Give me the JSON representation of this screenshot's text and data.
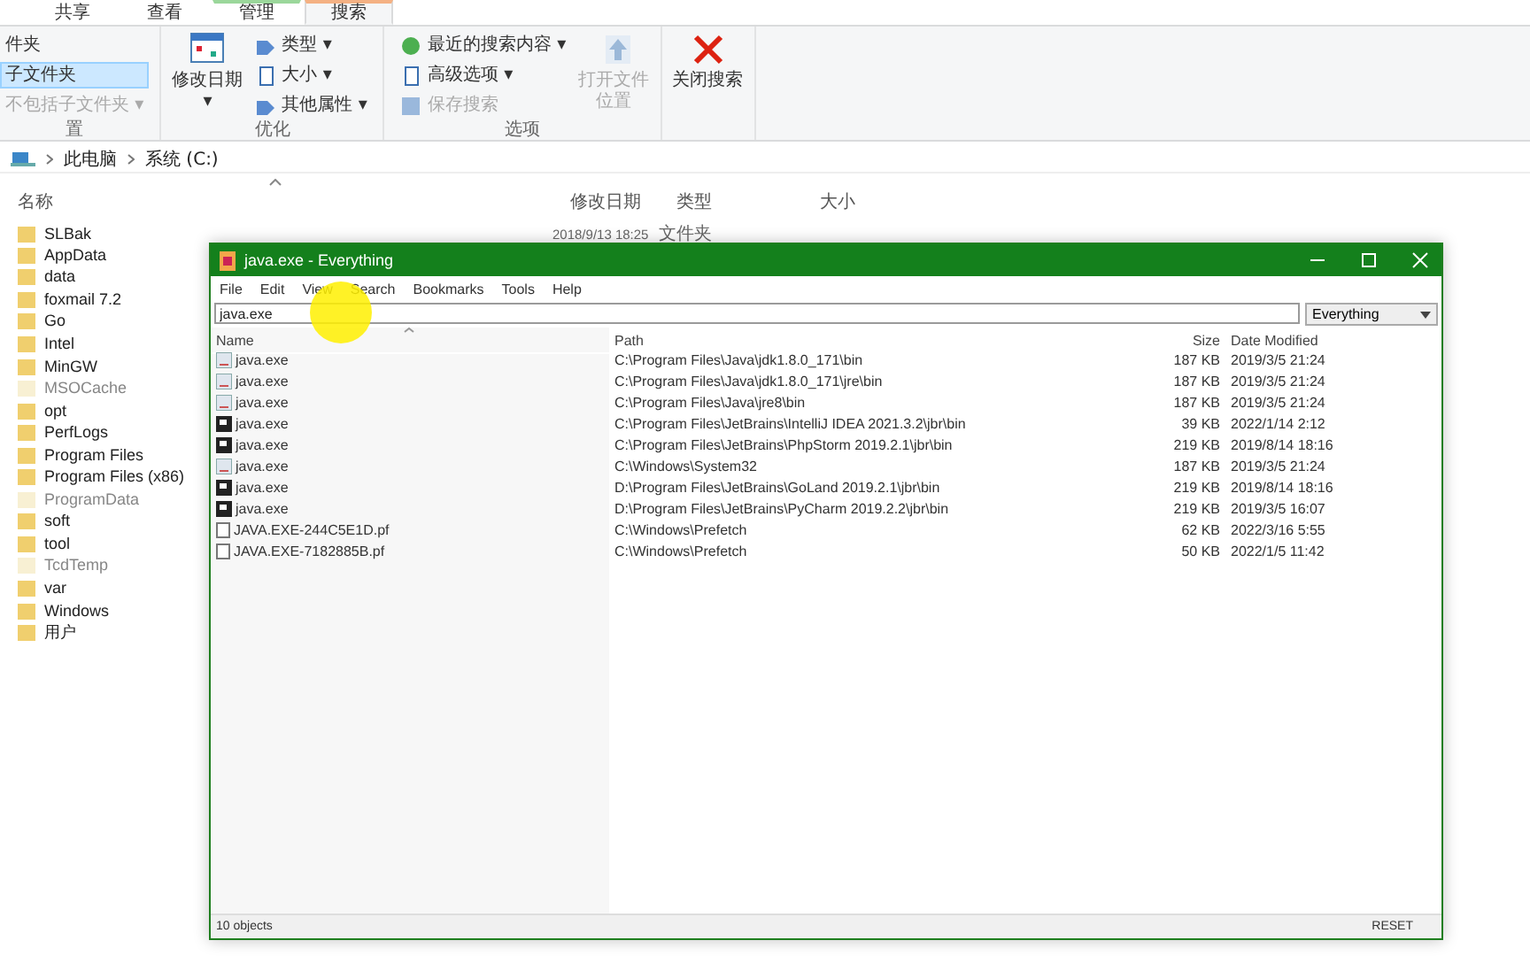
{
  "explorer": {
    "ribbon_tabs": [
      {
        "label": "共享",
        "selected": false
      },
      {
        "label": "查看",
        "selected": false
      },
      {
        "label": "管理",
        "selected": false,
        "color": "#9bd79b"
      },
      {
        "label": "搜索",
        "selected": true,
        "color": "#f4b183"
      }
    ],
    "ribbon_groups": [
      {
        "label": "置",
        "items": [
          {
            "kind": "small",
            "label": "件夹",
            "selected": false,
            "disabled": false
          },
          {
            "kind": "small",
            "label": "子文件夹",
            "selected": true,
            "disabled": false
          },
          {
            "kind": "small",
            "label": "不包括子文件夹 ▾",
            "selected": false,
            "disabled": true
          }
        ]
      },
      {
        "label": "优化",
        "items": [
          {
            "kind": "large",
            "label": "修改日期 ▾",
            "disabled": false
          },
          {
            "kind": "small",
            "label": "类型 ▾",
            "disabled": false
          },
          {
            "kind": "small",
            "label": "大小 ▾",
            "disabled": false
          },
          {
            "kind": "small",
            "label": "其他属性 ▾",
            "disabled": false
          }
        ]
      },
      {
        "label": "选项",
        "items": [
          {
            "kind": "small",
            "label": "最近的搜索内容 ▾",
            "disabled": false
          },
          {
            "kind": "small",
            "label": "高级选项 ▾",
            "disabled": false
          },
          {
            "kind": "small",
            "label": "保存搜索",
            "disabled": true
          },
          {
            "kind": "large",
            "label": "打开文件位置",
            "disabled": true
          }
        ]
      },
      {
        "items": [
          {
            "kind": "large",
            "label": "关闭搜索",
            "disabled": false
          }
        ]
      }
    ],
    "breadcrumb": [
      "此电脑",
      "系统 (C:)"
    ],
    "columns": [
      "名称",
      "修改日期",
      "类型",
      "大小"
    ],
    "first_row": {
      "date": "2018/9/13 18:25",
      "type": "文件夹"
    },
    "folders": [
      {
        "name": "SLBak",
        "hidden": false
      },
      {
        "name": "AppData",
        "hidden": false
      },
      {
        "name": "data",
        "hidden": false
      },
      {
        "name": "foxmail 7.2",
        "hidden": false
      },
      {
        "name": "Go",
        "hidden": false
      },
      {
        "name": "Intel",
        "hidden": false
      },
      {
        "name": "MinGW",
        "hidden": false
      },
      {
        "name": "MSOCache",
        "hidden": true
      },
      {
        "name": "opt",
        "hidden": false
      },
      {
        "name": "PerfLogs",
        "hidden": false
      },
      {
        "name": "Program Files",
        "hidden": false
      },
      {
        "name": "Program Files (x86)",
        "hidden": false
      },
      {
        "name": "ProgramData",
        "hidden": true
      },
      {
        "name": "soft",
        "hidden": false
      },
      {
        "name": "tool",
        "hidden": false
      },
      {
        "name": "TcdTemp",
        "hidden": true
      },
      {
        "name": "var",
        "hidden": false
      },
      {
        "name": "Windows",
        "hidden": false
      },
      {
        "name": "用户",
        "hidden": false
      }
    ]
  },
  "everything": {
    "title": "java.exe - Everything",
    "menu": [
      "File",
      "Edit",
      "View",
      "Search",
      "Bookmarks",
      "Tools",
      "Help"
    ],
    "search": {
      "value": "java.exe"
    },
    "filter": "Everything",
    "columns": [
      "Name",
      "Path",
      "Size",
      "Date Modified"
    ],
    "rows": [
      {
        "kind": "java",
        "name": "java.exe",
        "path": "C:\\Program Files\\Java\\jdk1.8.0_171\\bin",
        "size": "187 KB",
        "date": "2019/3/5 21:24"
      },
      {
        "kind": "java",
        "name": "java.exe",
        "path": "C:\\Program Files\\Java\\jdk1.8.0_171\\jre\\bin",
        "size": "187 KB",
        "date": "2019/3/5 21:24"
      },
      {
        "kind": "java",
        "name": "java.exe",
        "path": "C:\\Program Files\\Java\\jre8\\bin",
        "size": "187 KB",
        "date": "2019/3/5 21:24"
      },
      {
        "kind": "app",
        "name": "java.exe",
        "path": "C:\\Program Files\\JetBrains\\IntelliJ IDEA 2021.3.2\\jbr\\bin",
        "size": "39 KB",
        "date": "2022/1/14 2:12"
      },
      {
        "kind": "app",
        "name": "java.exe",
        "path": "C:\\Program Files\\JetBrains\\PhpStorm 2019.2.1\\jbr\\bin",
        "size": "219 KB",
        "date": "2019/8/14 18:16"
      },
      {
        "kind": "java",
        "name": "java.exe",
        "path": "C:\\Windows\\System32",
        "size": "187 KB",
        "date": "2019/3/5 21:24"
      },
      {
        "kind": "app",
        "name": "java.exe",
        "path": "D:\\Program Files\\JetBrains\\GoLand 2019.2.1\\jbr\\bin",
        "size": "219 KB",
        "date": "2019/8/14 18:16"
      },
      {
        "kind": "app",
        "name": "java.exe",
        "path": "D:\\Program Files\\JetBrains\\PyCharm 2019.2.2\\jbr\\bin",
        "size": "219 KB",
        "date": "2019/3/5 16:07"
      },
      {
        "kind": "file",
        "name": "JAVA.EXE-244C5E1D.pf",
        "path": "C:\\Windows\\Prefetch",
        "size": "62 KB",
        "date": "2022/3/16 5:55"
      },
      {
        "kind": "file",
        "name": "JAVA.EXE-7182885B.pf",
        "path": "C:\\Windows\\Prefetch",
        "size": "50 KB",
        "date": "2022/1/5 11:42"
      }
    ],
    "status": "10 objects",
    "status_right": "RESET"
  }
}
